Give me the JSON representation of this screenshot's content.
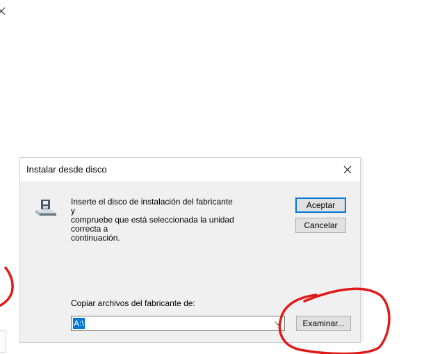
{
  "dialog": {
    "title": "Instalar desde disco",
    "instructions": "Inserte el disco de instalación del fabricante y\ncompruebe que está seleccionada la unidad correcta a\ncontinuación.",
    "accept_label": "Aceptar",
    "cancel_label": "Cancelar",
    "copy_from_label": "Copiar archivos del fabricante de:",
    "path_value": "A:\\",
    "browse_label": "Examinar..."
  },
  "colors": {
    "selection": "#0078d7",
    "annotation": "#e01a1a"
  },
  "icons": [
    "close-icon",
    "floppy-disk-icon",
    "chevron-down-icon"
  ]
}
